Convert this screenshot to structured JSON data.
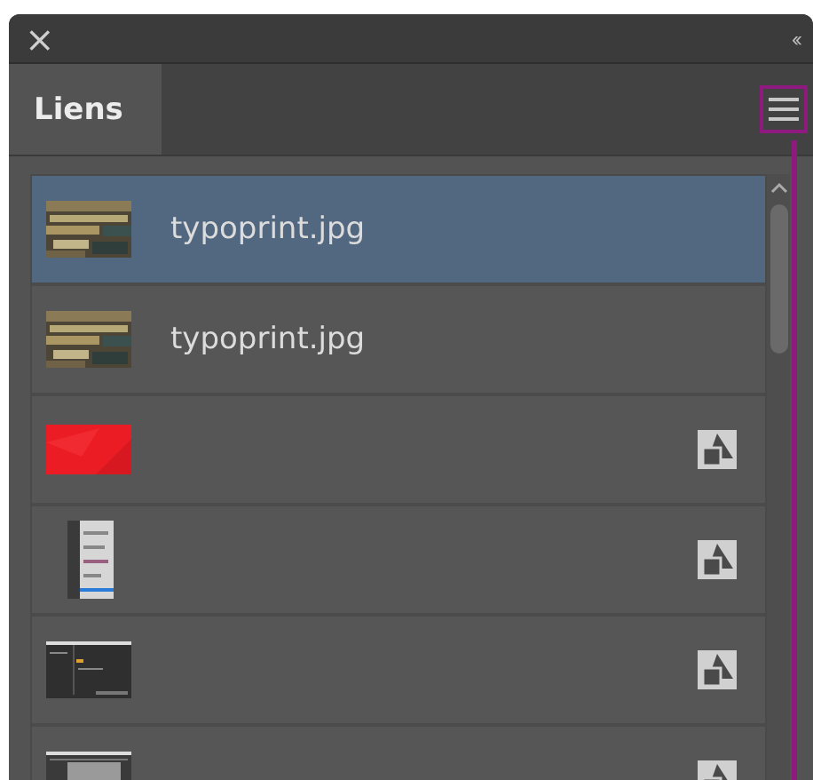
{
  "window": {
    "close": "×",
    "collapse": "‹‹"
  },
  "tabs": [
    {
      "label": "Liens",
      "selected": true
    }
  ],
  "links": [
    {
      "name": "typoprint.jpg",
      "selected": true,
      "embedded": false
    },
    {
      "name": "typoprint.jpg",
      "selected": false,
      "embedded": false
    },
    {
      "kind": "red",
      "selected": false,
      "embedded": true
    },
    {
      "kind": "menu",
      "selected": false,
      "embedded": true
    },
    {
      "kind": "dialog",
      "selected": false,
      "embedded": true
    },
    {
      "kind": "window",
      "selected": false,
      "embedded": true
    }
  ]
}
